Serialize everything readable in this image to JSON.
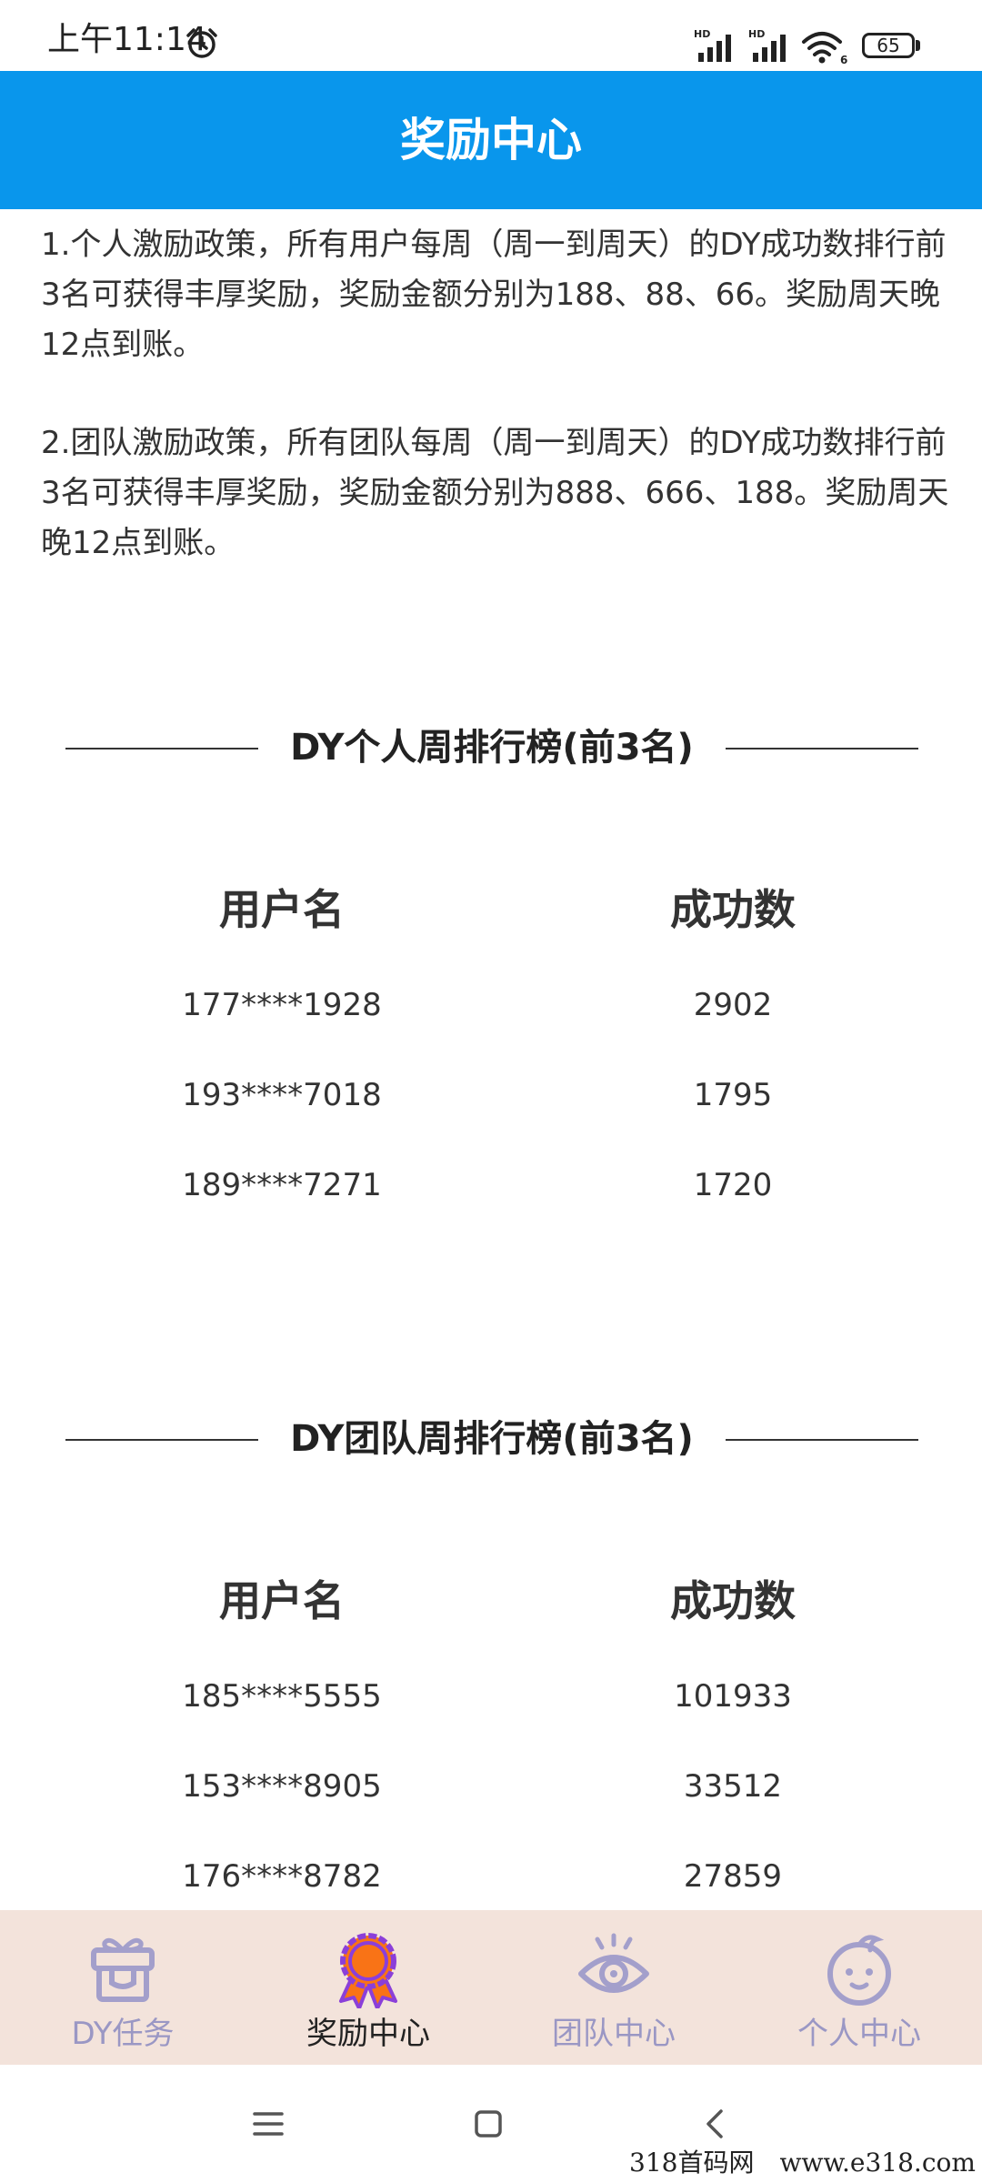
{
  "status_bar": {
    "time": "上午11:14",
    "battery": "65",
    "signal_1_label": "HD",
    "signal_2_label": "HD",
    "wifi_label": "6"
  },
  "header": {
    "title": "奖励中心"
  },
  "policy": {
    "personal": "1.个人激励政策，所有用户每周（周一到周天）的DY成功数排行前3名可获得丰厚奖励，奖励金额分别为188、88、66。奖励周天晚12点到账。",
    "team": "2.团队激励政策，所有团队每周（周一到周天）的DY成功数排行前3名可获得丰厚奖励，奖励金额分别为888、666、188。奖励周天晚12点到账。"
  },
  "personal_ranking": {
    "title": "DY个人周排行榜(前3名)",
    "col_name": "用户名",
    "col_count": "成功数",
    "rows": [
      {
        "name": "177****1928",
        "count": "2902"
      },
      {
        "name": "193****7018",
        "count": "1795"
      },
      {
        "name": "189****7271",
        "count": "1720"
      }
    ]
  },
  "team_ranking": {
    "title": "DY团队周排行榜(前3名)",
    "col_name": "用户名",
    "col_count": "成功数",
    "rows": [
      {
        "name": "185****5555",
        "count": "101933"
      },
      {
        "name": "153****8905",
        "count": "33512"
      },
      {
        "name": "176****8782",
        "count": "27859"
      }
    ]
  },
  "tabs": [
    {
      "label": "DY任务",
      "icon": "gift-box-icon",
      "active": false
    },
    {
      "label": "奖励中心",
      "icon": "medal-icon",
      "active": true
    },
    {
      "label": "团队中心",
      "icon": "eye-icon",
      "active": false
    },
    {
      "label": "个人中心",
      "icon": "face-icon",
      "active": false
    }
  ],
  "colors": {
    "header_bg": "#0996ec",
    "tab_bar_bg": "#f3e3db",
    "tab_inactive": "#9a97c4",
    "medal_orange": "#f97316",
    "medal_purple": "#8b3fd9"
  },
  "system_nav": {
    "menu_icon": "menu-icon",
    "home_icon": "home-square-icon",
    "back_icon": "back-chevron-icon"
  },
  "watermark": "318首码网　www.e318.com"
}
